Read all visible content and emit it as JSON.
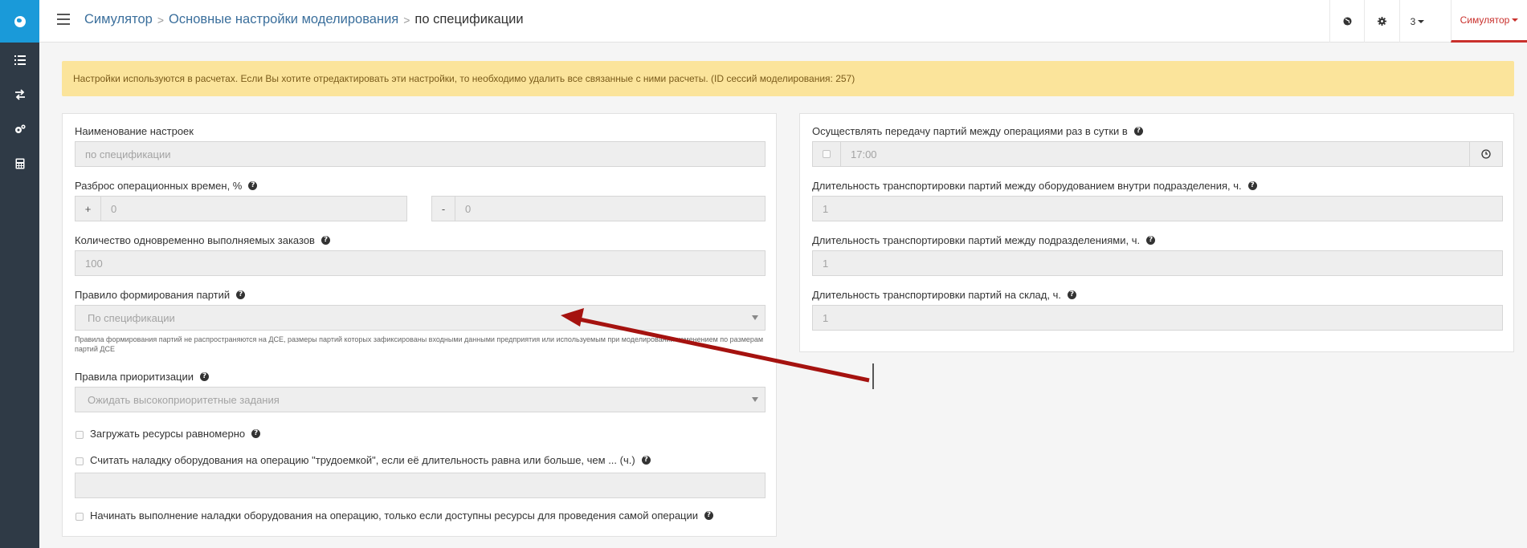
{
  "header": {
    "breadcrumb": [
      "Симулятор",
      "Основные настройки моделирования"
    ],
    "breadcrumb_current": "по спецификации",
    "user_menu_label": "3",
    "app_menu_label": "Симулятор"
  },
  "alert": {
    "text": "Настройки используются в расчетах. Если Вы хотите отредактировать эти настройки, то необходимо удалить все связанные с ними расчеты. (ID сессий моделирования: 257)"
  },
  "left": {
    "settings_name_label": "Наименование настроек",
    "settings_name_value": "по спецификации",
    "spread_label": "Разброс операционных времен, %",
    "spread_plus_symbol": "+",
    "spread_plus_value": "0",
    "spread_minus_symbol": "-",
    "spread_minus_value": "0",
    "concurrent_orders_label": "Количество одновременно выполняемых заказов",
    "concurrent_orders_value": "100",
    "batch_rule_label": "Правило формирования партий",
    "batch_rule_value": "По спецификации",
    "batch_rule_hint": "Правила формирования партий не распространяются на ДСЕ, размеры партий которых зафиксированы входными данными предприятия или используемым при моделировании изменением по размерам партий ДСЕ",
    "priority_label": "Правила приоритизации",
    "priority_value": "Ожидать высокоприоритетные задания",
    "load_evenly_label": "Загружать ресурсы равномерно",
    "setup_labor_label": "Считать наладку оборудования на операцию \"трудоемкой\", если её длительность равна или больше, чем ... (ч.)",
    "setup_labor_value": "",
    "start_setup_label": "Начинать выполнение наладки оборудования на операцию, только если доступны ресурсы для проведения самой операции"
  },
  "right": {
    "transfer_daily_label": "Осуществлять передачу партий между операциями раз в сутки в",
    "transfer_daily_time": "17:00",
    "transport_inner_label": "Длительность транспортировки партий между оборудованием внутри подразделения, ч.",
    "transport_inner_value": "1",
    "transport_between_label": "Длительность транспортировки партий между подразделениями, ч.",
    "transport_between_value": "1",
    "transport_warehouse_label": "Длительность транспортировки партий на склад, ч.",
    "transport_warehouse_value": "1"
  },
  "help_glyph": "?",
  "colors": {
    "sidebar": "#2f3a46",
    "logo": "#1a9ad9",
    "accent": "#c9302c",
    "alert_bg": "#fbe49b",
    "link": "#3b6f9c",
    "annotation_arrow": "#a5120f"
  },
  "icons": {
    "sidebar": [
      "list-icon",
      "transfer-arrows-icon",
      "gears-icon",
      "calculator-icon"
    ],
    "header": [
      "globe-icon",
      "gear-icon"
    ]
  }
}
